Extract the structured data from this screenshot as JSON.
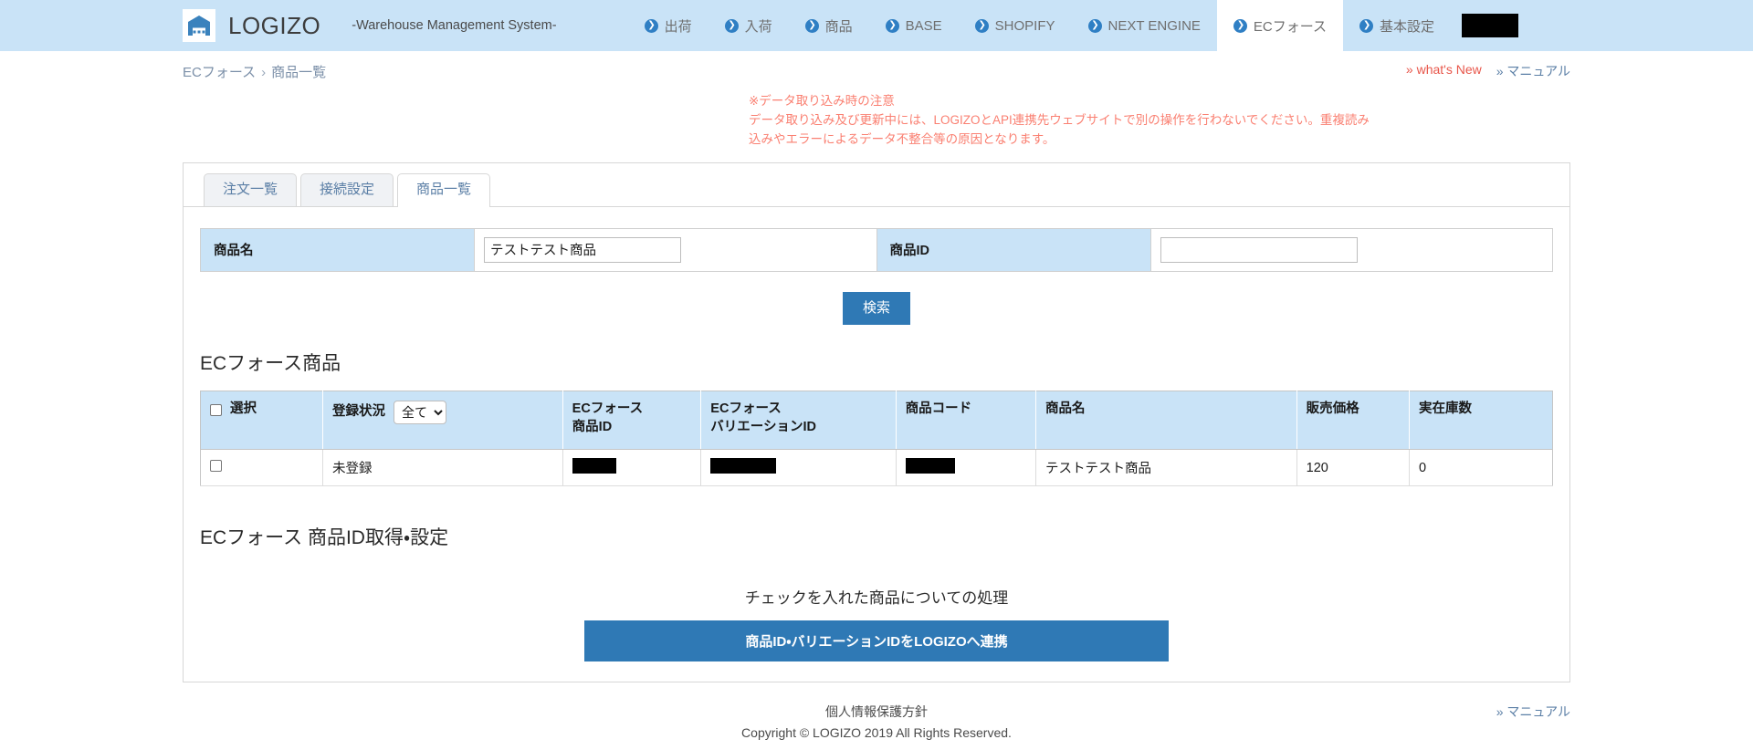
{
  "header": {
    "brand_name": "LOGIZO",
    "brand_subtitle": "-Warehouse Management System-",
    "logo_icon": "warehouse-icon",
    "nav": [
      {
        "label": "出荷",
        "icon": "chevron-circle-right-icon",
        "active": false
      },
      {
        "label": "入荷",
        "icon": "chevron-circle-right-icon",
        "active": false
      },
      {
        "label": "商品",
        "icon": "chevron-circle-right-icon",
        "active": false
      },
      {
        "label": "BASE",
        "icon": "chevron-circle-right-icon",
        "active": false
      },
      {
        "label": "SHOPIFY",
        "icon": "chevron-circle-right-icon",
        "active": false
      },
      {
        "label": "NEXT ENGINE",
        "icon": "chevron-circle-right-icon",
        "active": false
      },
      {
        "label": "ECフォース",
        "icon": "chevron-circle-right-icon",
        "active": true
      },
      {
        "label": "基本設定",
        "icon": "chevron-circle-right-icon",
        "active": false
      }
    ],
    "redacted_account": ""
  },
  "breadcrumb": {
    "root": "ECフォース",
    "separator": "›",
    "current": "商品一覧"
  },
  "toplinks": {
    "whats_new": "» what's New",
    "manual": "» マニュアル"
  },
  "notice": {
    "line1": "※データ取り込み時の注意",
    "line2": "データ取り込み及び更新中には、LOGIZOとAPI連携先ウェブサイトで別の操作を行わないでください。重複読み",
    "line3": "込みやエラーによるデータ不整合等の原因となります。"
  },
  "tabs": [
    {
      "label": "注文一覧",
      "active": false
    },
    {
      "label": "接続設定",
      "active": false
    },
    {
      "label": "商品一覧",
      "active": true
    }
  ],
  "search": {
    "product_name_label": "商品名",
    "product_name_value": "テストテスト商品",
    "product_name_placeholder": "",
    "product_id_label": "商品ID",
    "product_id_value": "",
    "product_id_placeholder": "",
    "submit_label": "検索"
  },
  "products_section": {
    "title": "ECフォース商品",
    "columns": [
      "選択",
      "登録状況",
      "ECフォース\n商品ID",
      "ECフォース\nバリエーションID",
      "商品コード",
      "商品名",
      "販売価格",
      "実在庫数"
    ],
    "col_select_label": "選択",
    "col_status_label": "登録状況",
    "col_ecforce_id_line1": "ECフォース",
    "col_ecforce_id_line2": "商品ID",
    "col_ecforce_var_line1": "ECフォース",
    "col_ecforce_var_line2": "バリエーションID",
    "col_product_code": "商品コード",
    "col_product_name": "商品名",
    "col_price": "販売価格",
    "col_stock": "実在庫数",
    "status_filter_selected": "全て",
    "status_filter_options": [
      "全て"
    ],
    "rows": [
      {
        "selected": false,
        "status": "未登録",
        "ecforce_product_id": "",
        "ecforce_variation_id": "",
        "product_code": "",
        "product_name": "テストテスト商品",
        "price": "120",
        "stock": "0"
      }
    ]
  },
  "actions_section": {
    "title": "ECフォース 商品ID取得・設定",
    "caption": "チェックを入れた商品についての処理",
    "button_label": "商品ID・バリエーションIDをLOGIZOへ連携"
  },
  "footer": {
    "privacy": "個人情報保護方針",
    "copyright": "Copyright © LOGIZO 2019 All Rights Reserved.",
    "manual": "» マニュアル"
  },
  "colors": {
    "header_bg": "#c9e3f7",
    "accent_blue": "#2f79b5",
    "notice_red": "#fa8072",
    "link_blue": "#5b7fa6",
    "link_red": "#e8564a"
  }
}
